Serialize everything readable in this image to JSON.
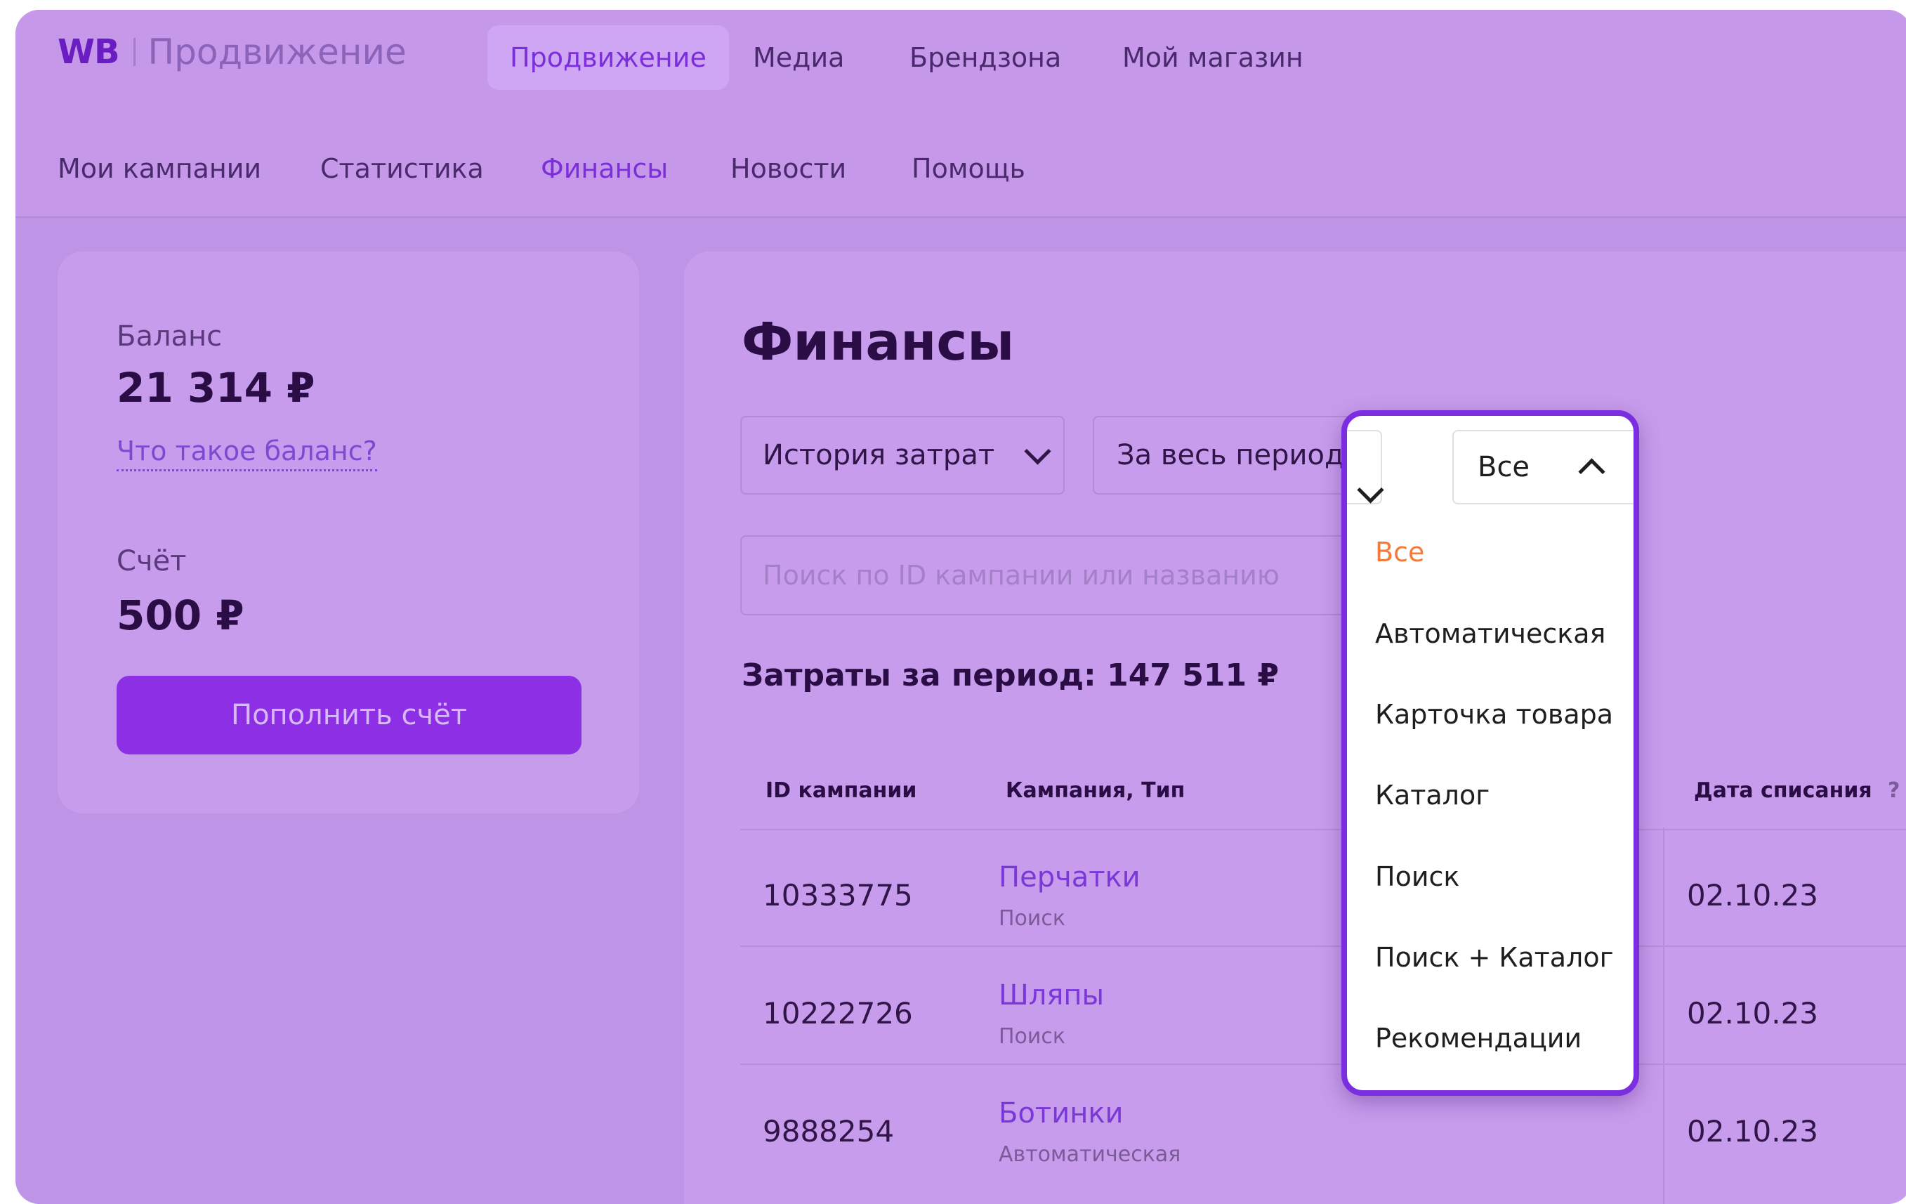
{
  "header": {
    "logo_mark": "WB",
    "logo_text": "Продвижение",
    "tabs": [
      {
        "label": "Продвижение",
        "active": true
      },
      {
        "label": "Медиа"
      },
      {
        "label": "Брендзона"
      },
      {
        "label": "Мой магазин"
      }
    ]
  },
  "subnav": {
    "tabs": [
      {
        "label": "Мои кампании"
      },
      {
        "label": "Статистика"
      },
      {
        "label": "Финансы",
        "active": true
      },
      {
        "label": "Новости"
      },
      {
        "label": "Помощь"
      }
    ]
  },
  "balance_card": {
    "balance_label": "Баланс",
    "balance_value": "21 314 ₽",
    "balance_help_link": "Что такое баланс?",
    "account_label": "Счёт",
    "account_value": "500 ₽",
    "topup_button": "Пополнить счёт"
  },
  "finances": {
    "title": "Финансы",
    "filter_history": "История затрат",
    "filter_period": "За весь период",
    "search_placeholder": "Поиск по ID кампании или названию",
    "period_total": "Затраты за период: 147 511 ₽",
    "table": {
      "headers": {
        "id": "ID кампании",
        "campaign": "Кампания, Тип",
        "date": "Дата списания",
        "date_hint": "?"
      },
      "rows": [
        {
          "id": "10333775",
          "name": "Перчатки",
          "type": "Поиск",
          "date": "02.10.23"
        },
        {
          "id": "10222726",
          "name": "Шляпы",
          "type": "Поиск",
          "date": "02.10.23"
        },
        {
          "id": "9888254",
          "name": "Ботинки",
          "type": "Автоматическая",
          "date": "02.10.23"
        }
      ]
    }
  },
  "type_dropdown": {
    "selected_label": "Все",
    "options": [
      "Все",
      "Автоматическая",
      "Карточка товара",
      "Каталог",
      "Поиск",
      "Поиск + Каталог",
      "Рекомендации"
    ],
    "highlight_color": "#f47a3c",
    "border_color": "#7b2de0"
  },
  "colors": {
    "accent": "#8c2fe5",
    "link": "#7a38d8",
    "overlay_bg": "#bd94e6"
  }
}
